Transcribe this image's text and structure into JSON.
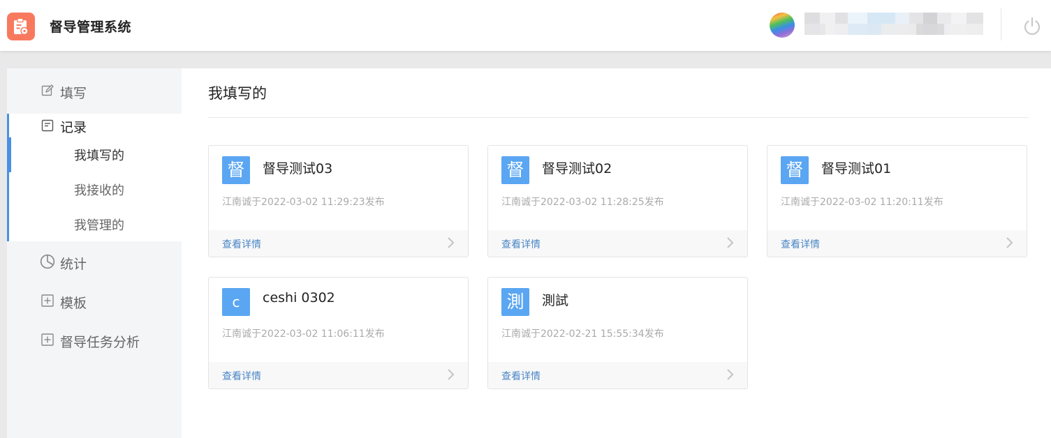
{
  "header": {
    "app_title": "督导管理系统",
    "logo_icon": "clipboard-icon",
    "power_icon": "power-icon"
  },
  "sidebar": {
    "items": [
      {
        "label": "填写",
        "icon": "edit-icon"
      },
      {
        "label": "记录",
        "icon": "document-icon"
      },
      {
        "label": "统计",
        "icon": "pie-chart-icon"
      },
      {
        "label": "模板",
        "icon": "plus-square-icon"
      },
      {
        "label": "督导任务分析",
        "icon": "plus-square-icon"
      }
    ],
    "records_sub": [
      {
        "label": "我填写的",
        "active": true
      },
      {
        "label": "我接收的",
        "active": false
      },
      {
        "label": "我管理的",
        "active": false
      }
    ]
  },
  "main": {
    "title": "我填写的",
    "cards": [
      {
        "badge": "督",
        "title": "督导测试03",
        "meta": "江南诚于2022-03-02 11:29:23发布",
        "link": "查看详情"
      },
      {
        "badge": "督",
        "title": "督导测试02",
        "meta": "江南诚于2022-03-02 11:28:25发布",
        "link": "查看详情"
      },
      {
        "badge": "督",
        "title": "督导测试01",
        "meta": "江南诚于2022-03-02 11:20:11发布",
        "link": "查看详情"
      },
      {
        "badge": "c",
        "title": "ceshi 0302",
        "meta": "江南诚于2022-03-02 11:06:11发布",
        "link": "查看详情"
      },
      {
        "badge": "測",
        "title": "測試",
        "meta": "江南诚于2022-02-21 15:55:34发布",
        "link": "查看详情"
      }
    ]
  },
  "colors": {
    "accent": "#4a90e2",
    "badge": "#5aa6f2",
    "logo": "#f87a5e",
    "link": "#4a86c5"
  }
}
